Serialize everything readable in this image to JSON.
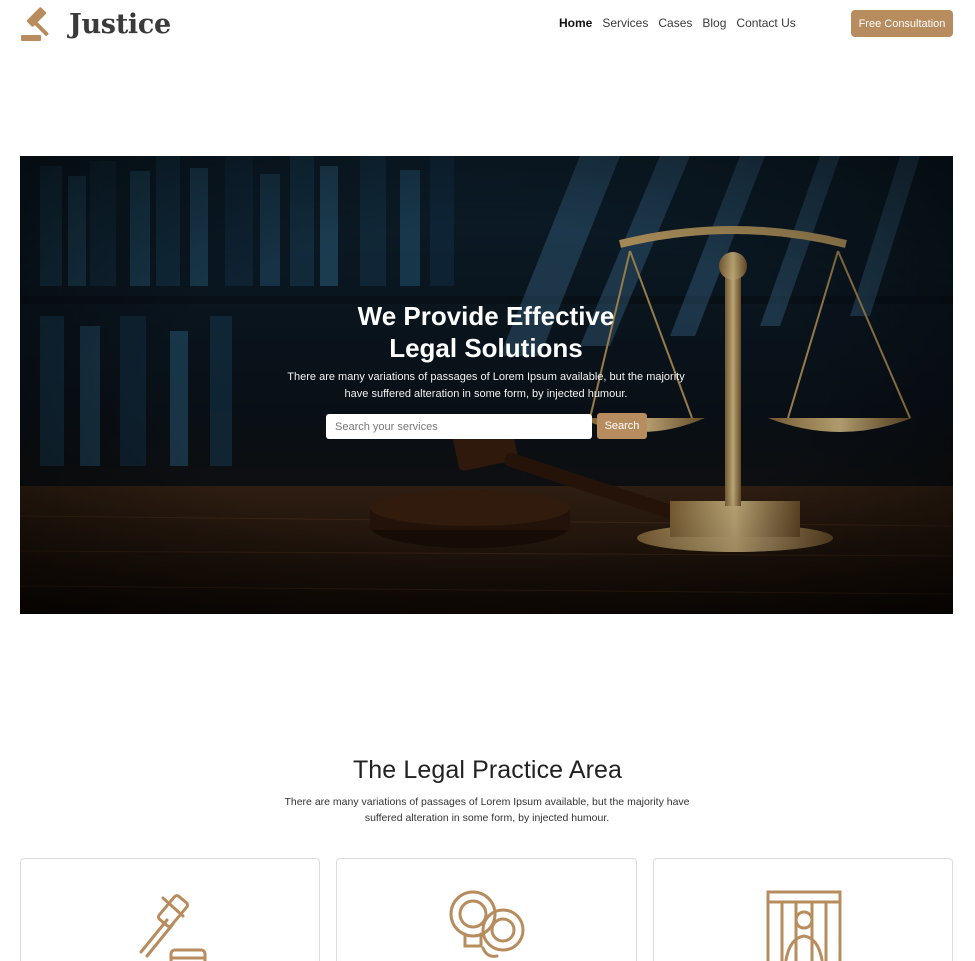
{
  "brand": {
    "name": "Justice",
    "logo_icon": "gavel-icon",
    "accent": "#b78c5e"
  },
  "nav": {
    "items": [
      {
        "label": "Home",
        "active": true
      },
      {
        "label": "Services",
        "active": false
      },
      {
        "label": "Cases",
        "active": false
      },
      {
        "label": "Blog",
        "active": false
      },
      {
        "label": "Contact Us",
        "active": false
      }
    ],
    "cta_label": "Free Consultation"
  },
  "hero": {
    "title_line1": "We Provide Effective",
    "title_line2": "Legal Solutions",
    "subtitle_line1": "There are many variations of passages of Lorem Ipsum available, but the majority",
    "subtitle_line2": "have suffered alteration in some form, by injected humour.",
    "search_placeholder": "Search your services",
    "search_button": "Search"
  },
  "practice": {
    "title": "The Legal Practice Area",
    "subtitle_line1": "There are many variations of passages of Lorem Ipsum available, but the majority have",
    "subtitle_line2": "suffered alteration in some form, by injected humour.",
    "cards": [
      {
        "icon": "gavel-icon"
      },
      {
        "icon": "handcuffs-icon"
      },
      {
        "icon": "prison-icon"
      }
    ]
  }
}
